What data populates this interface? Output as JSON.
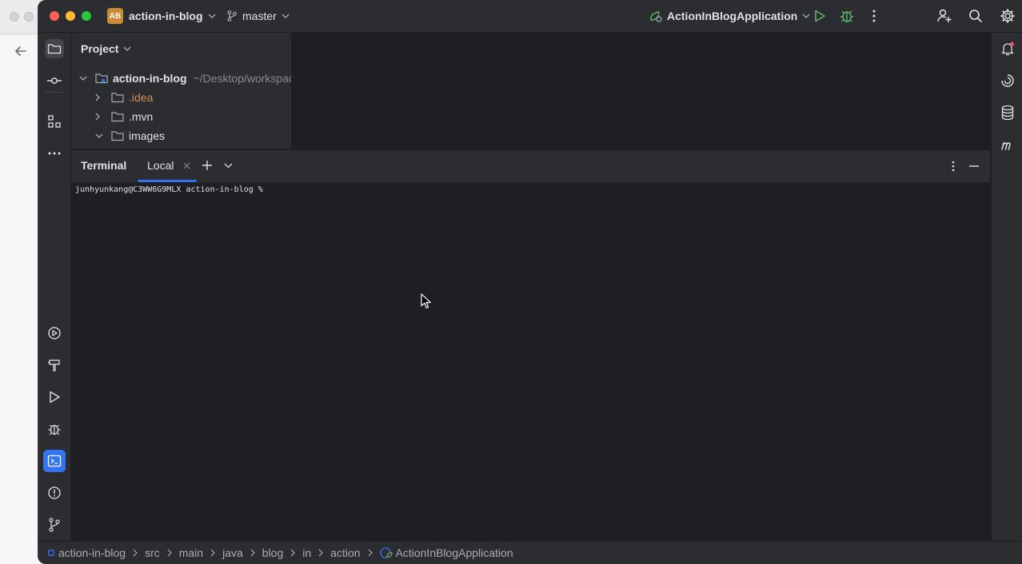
{
  "window": {
    "project_badge": "AB",
    "project_name": "action-in-blog",
    "branch": "master",
    "run_config": "ActionInBlogApplication"
  },
  "project_panel": {
    "title": "Project",
    "tree": [
      {
        "label": "action-in-blog",
        "path": "~/Desktop/workspac",
        "expanded": true
      },
      {
        "label": ".idea",
        "expanded": false
      },
      {
        "label": ".mvn",
        "expanded": false
      },
      {
        "label": "images",
        "expanded": true
      }
    ]
  },
  "terminal": {
    "title": "Terminal",
    "tab_label": "Local",
    "prompt": "junhyunkang@C3WW6G9MLX action-in-blog %"
  },
  "breadcrumb": [
    "action-in-blog",
    "src",
    "main",
    "java",
    "blog",
    "in",
    "action",
    "ActionInBlogApplication"
  ],
  "colors": {
    "accent": "#3574f0",
    "run_green": "#5fb865",
    "badge": "#c98b35",
    "idea_folder": "#d0895a",
    "notification_dot": "#e55b5b"
  },
  "icons": {
    "left_strip_top": [
      "folder-icon",
      "commit-icon",
      "structure-icon",
      "more-icon"
    ],
    "left_strip_bottom": [
      "services-icon",
      "build-icon",
      "run-icon",
      "debug-icon",
      "terminal-icon",
      "problems-icon",
      "git-icon"
    ],
    "right_strip": [
      "notifications-icon",
      "ai-assistant-icon",
      "database-icon",
      "maven-icon"
    ]
  }
}
